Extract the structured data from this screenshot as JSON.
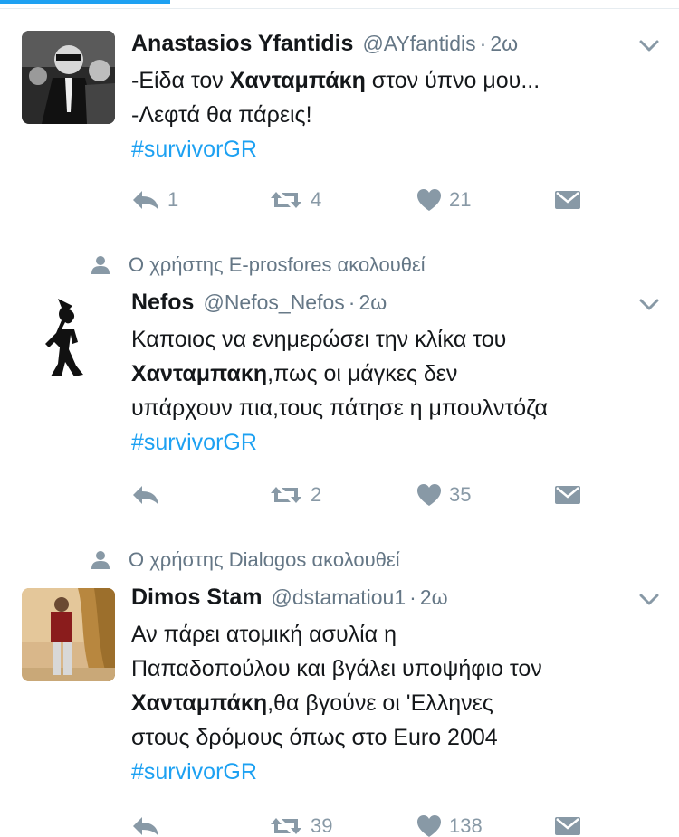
{
  "colors": {
    "accent": "#1da1f2",
    "muted": "#657786",
    "icon": "#8899a6",
    "divider": "#e1e8ed"
  },
  "tweets": [
    {
      "name": "Anastasios Yfantidis",
      "handle": "@AYfantidis",
      "sep": "·",
      "time": "2ω",
      "lines": [
        {
          "pre": "-Είδα τον ",
          "bold": "Χανταμπάκη",
          "post": " στον ύπνο μου..."
        },
        {
          "pre": "-Λεφτά θα πάρεις!",
          "bold": "",
          "post": ""
        }
      ],
      "hashtag": "#survivorGR",
      "reply_count": "1",
      "retweet_count": "4",
      "like_count": "21",
      "icons": [
        "reply-icon",
        "retweet-icon",
        "like-icon",
        "direct-message-icon",
        "chevron-down-icon"
      ]
    },
    {
      "context": "Ο χρήστης E-prosfores ακολουθεί",
      "name": "Nefos",
      "handle": "@Nefos_Nefos",
      "sep": "·",
      "time": "2ω",
      "lines": [
        {
          "pre": "Καποιος να ενημερώσει την κλίκα του",
          "bold": "",
          "post": ""
        },
        {
          "pre": "",
          "bold": "Χανταμπακη",
          "post": ",πως οι μάγκες δεν"
        },
        {
          "pre": "υπάρχουν πια,τους πάτησε η μπουλντόζα",
          "bold": "",
          "post": ""
        }
      ],
      "hashtag": "#survivorGR",
      "reply_count": "",
      "retweet_count": "2",
      "like_count": "35"
    },
    {
      "context": "Ο χρήστης Dialogos ακολουθεί",
      "name": "Dimos Stam",
      "handle": "@dstamatiou1",
      "sep": "·",
      "time": "2ω",
      "lines": [
        {
          "pre": "Αν πάρει ατομική ασυλία η",
          "bold": "",
          "post": ""
        },
        {
          "pre": "Παπαδοπούλου και βγάλει υποψήφιο τον",
          "bold": "",
          "post": ""
        },
        {
          "pre": "",
          "bold": "Χανταμπάκη",
          "post": ",θα βγούνε οι 'Ελληνες"
        },
        {
          "pre": "στους δρόμους όπως στο Euro 2004",
          "bold": "",
          "post": ""
        }
      ],
      "hashtag": "#survivorGR",
      "reply_count": "",
      "retweet_count": "39",
      "like_count": "138"
    }
  ]
}
